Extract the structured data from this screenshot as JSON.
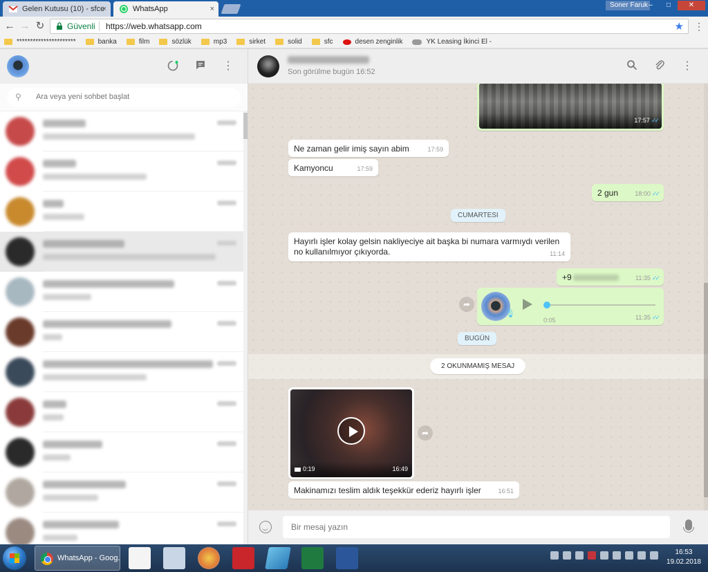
{
  "browser": {
    "tabs": [
      {
        "label": "Gelen Kutusu (10) - sfce",
        "close": "×"
      },
      {
        "label": "WhatsApp",
        "close": "×"
      }
    ],
    "window_user": "Soner Faruk",
    "window_buttons": {
      "minimize": "–",
      "maximize": "□",
      "close": "✕"
    },
    "secure_label": "Güvenli",
    "url": "https://web.whatsapp.com",
    "bookmarks": [
      "**********************",
      "banka",
      "film",
      "sözlük",
      "mp3",
      "sirket",
      "solid",
      "sfc",
      "desen zenginlik",
      "YK Leasing İkinci El -"
    ]
  },
  "left_panel": {
    "search_placeholder": "Ara veya yeni sohbet başlat",
    "header_icons": [
      "status-icon",
      "new-chat-icon",
      "menu-icon"
    ],
    "chats": [
      {
        "avatar_color": "#c74a4a",
        "selected": false
      },
      {
        "avatar_color": "#d24b4b",
        "selected": false
      },
      {
        "avatar_color": "#c98a2e",
        "selected": false
      },
      {
        "avatar_color": "#2a2a2a",
        "selected": true
      },
      {
        "avatar_color": "#a8b8c0",
        "selected": false
      },
      {
        "avatar_color": "#6a3a2a",
        "selected": false
      },
      {
        "avatar_color": "#3a4a5a",
        "selected": false
      },
      {
        "avatar_color": "#8a3a3a",
        "selected": false
      },
      {
        "avatar_color": "#2a2a2a",
        "selected": false
      },
      {
        "avatar_color": "#b0a8a0",
        "selected": false
      },
      {
        "avatar_color": "#9a8a80",
        "selected": false
      }
    ]
  },
  "conversation": {
    "last_seen": "Son görülme bugün 16:52",
    "header_icons": [
      "search-icon",
      "attach-icon",
      "menu-icon"
    ],
    "messages": {
      "image_top_time": "17:57",
      "m1_text": "Ne zaman gelir imiş sayın abim",
      "m1_time": "17:59",
      "m2_text": "Kamyoncu",
      "m2_time": "17:59",
      "m3_text": "2 gun",
      "m3_time": "18:00",
      "date_saturday": "CUMARTESI",
      "m4_text": "Hayırlı işler kolay gelsin nakliyeciye ait başka bi numara varmıydı verilen no kullanılmıyor çıkıyorda.",
      "m4_time": "11:14",
      "m5_prefix": "+9",
      "m5_time": "11:35",
      "voice_duration": "0:05",
      "voice_time": "11:35",
      "date_today": "BUGÜN",
      "unread_label": "2 OKUNMAMIŞ MESAJ",
      "video_duration": "0:19",
      "video_time": "16:49",
      "m6_text": "Makinamızı teslim aldık teşekkür ederiz hayırlı işler",
      "m6_time": "16:51"
    },
    "compose_placeholder": "Bir mesaj yazın"
  },
  "taskbar": {
    "active_app": "WhatsApp - Goog...",
    "time": "16:53",
    "date": "19.02.2018"
  },
  "colors": {
    "outgoing_bubble": "#dcf8c6",
    "incoming_bubble": "#ffffff",
    "chat_background": "#e4ddd5",
    "read_ticks": "#4fc3f7"
  }
}
